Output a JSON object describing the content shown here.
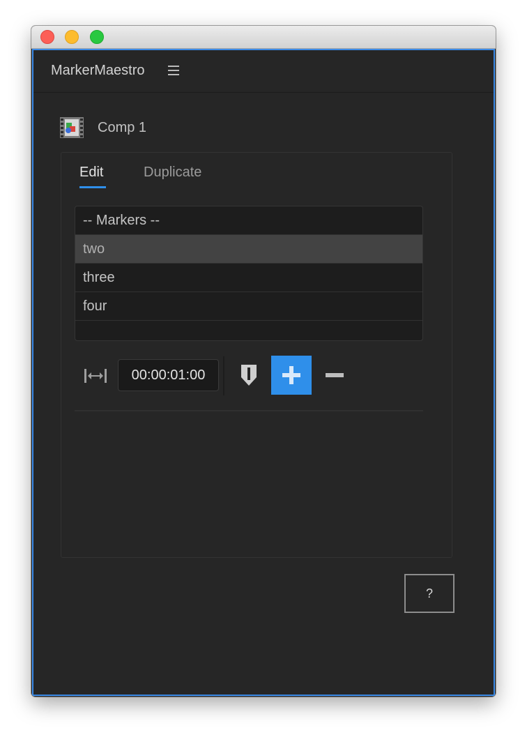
{
  "window": {
    "controls": [
      "close",
      "minimize",
      "maximize"
    ]
  },
  "panel": {
    "title": "MarkerMaestro",
    "menu_icon": "hamburger-menu-icon"
  },
  "composition": {
    "icon": "composition-icon",
    "name": "Comp 1"
  },
  "tabs": [
    {
      "label": "Edit",
      "active": true
    },
    {
      "label": "Duplicate",
      "active": false
    }
  ],
  "marker_list": {
    "items": [
      {
        "label": "-- Markers --",
        "selected": false
      },
      {
        "label": "two",
        "selected": true
      },
      {
        "label": "three",
        "selected": false
      },
      {
        "label": "four",
        "selected": false
      },
      {
        "label": "",
        "selected": false
      }
    ]
  },
  "toolbar": {
    "duration_icon": "duration-icon",
    "duration_value": "00:00:01:00",
    "marker_icon": "marker-icon",
    "add_icon": "plus-icon",
    "remove_icon": "minus-icon"
  },
  "help": {
    "label": "?"
  },
  "colors": {
    "accent": "#2f8fea",
    "panel_bg": "#262626",
    "list_bg": "#1d1d1d",
    "selected_row": "#434343"
  }
}
